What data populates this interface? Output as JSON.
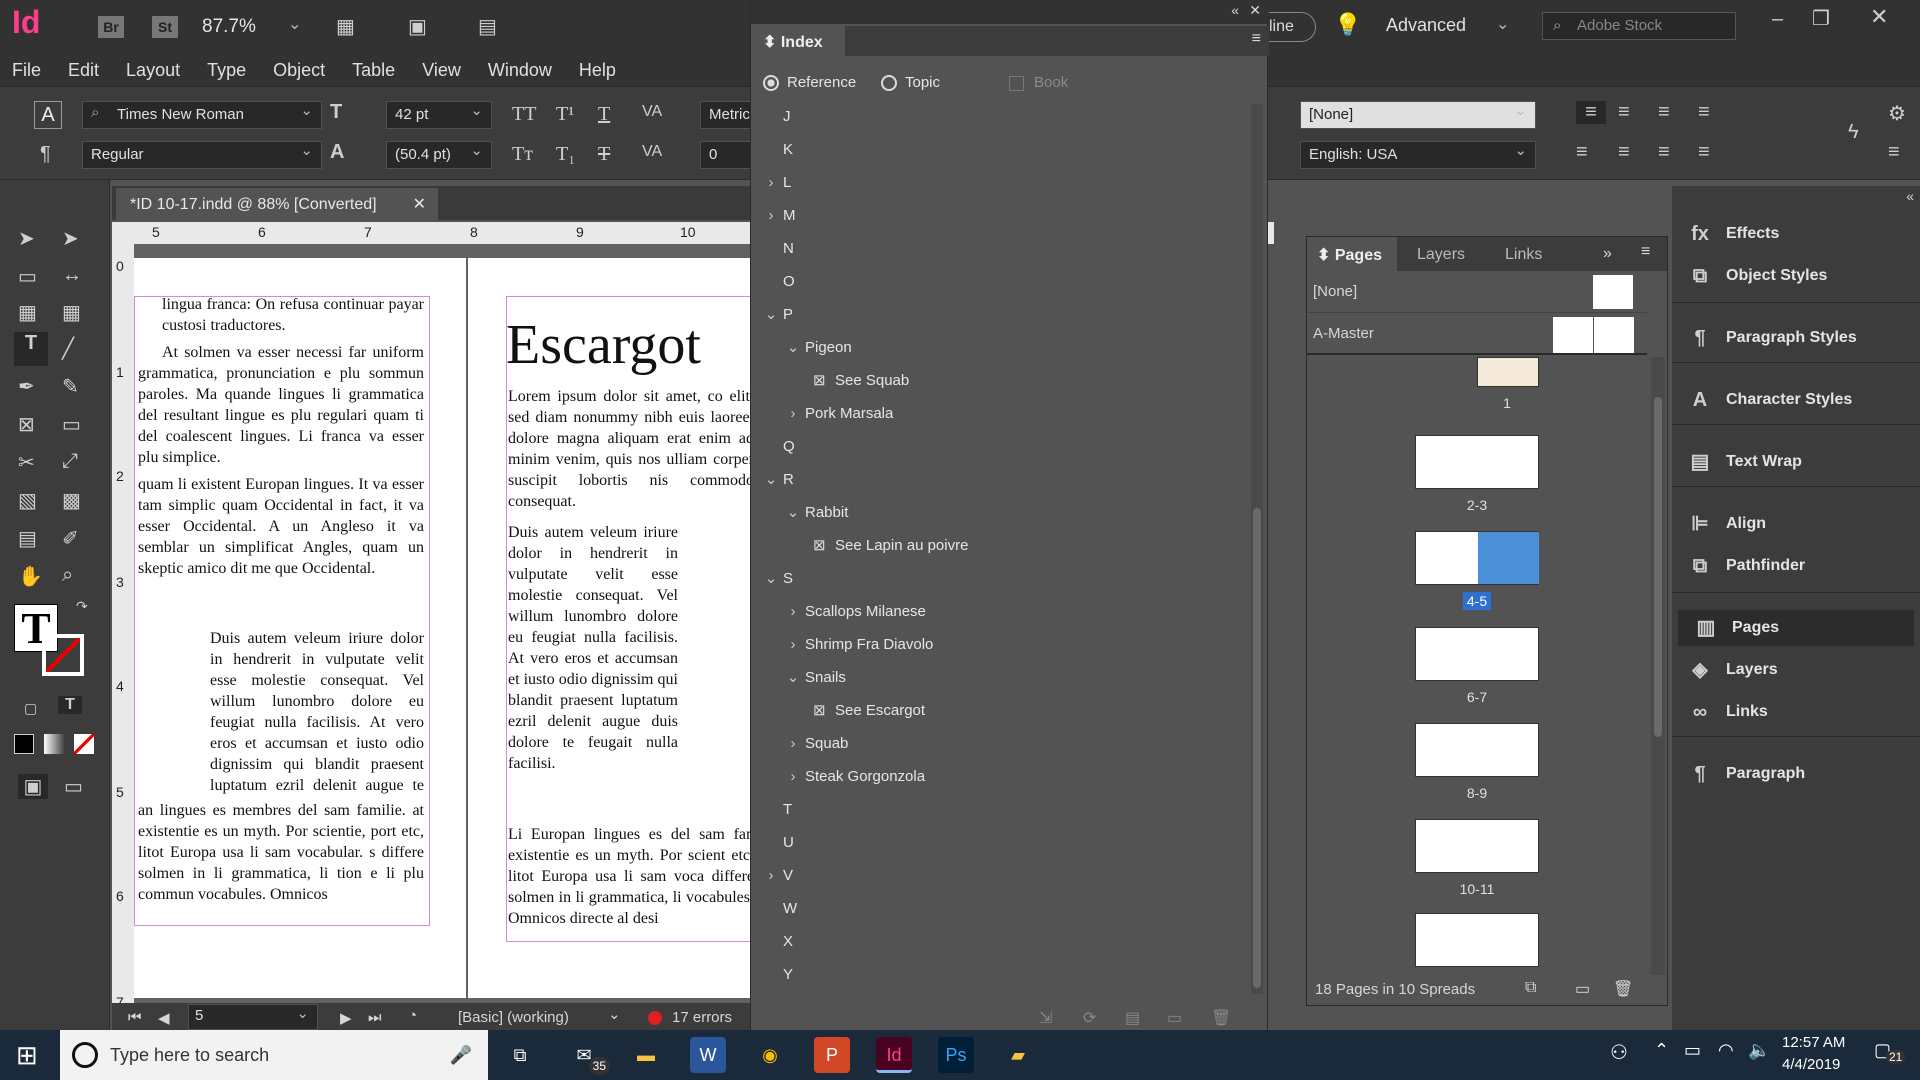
{
  "app": {
    "logo": "Id",
    "bridge": "Br",
    "stock": "St",
    "zoom": "87.7%",
    "workspace": "Advanced",
    "search_placeholder": "Adobe Stock",
    "online": "line"
  },
  "menu": [
    "File",
    "Edit",
    "Layout",
    "Type",
    "Object",
    "Table",
    "View",
    "Window",
    "Help"
  ],
  "control": {
    "font_family": "Times New Roman",
    "font_style": "Regular",
    "font_size": "42 pt",
    "leading": "(50.4 pt)",
    "kerning": "Metrics",
    "tracking": "0",
    "para_style": "[None]",
    "language": "English: USA"
  },
  "document": {
    "tab_title": "*ID 10-17.indd @ 88% [Converted]",
    "ruler_h": [
      "5",
      "6",
      "7",
      "8",
      "9",
      "10"
    ],
    "ruler_v": [
      "0",
      "1",
      "2",
      "3",
      "4",
      "5",
      "6",
      "7"
    ],
    "heading": "Escargot",
    "left_col": [
      "lingua franca: On refusa continuar payar custosi traductores.",
      "At solmen va esser necessi far uniform grammatica, pronunciation e plu sommun paroles. Ma quande lingues li grammatica del resultant lingue es plu regulari quam ti del coalescent lingues. Li franca va esser plu simplice.",
      "quam li existent Europan lingues. It va esser tam simplic quam Occidental in fact, it va esser Occidental. A un Angleso it va semblar un simplificat Angles, quam un skeptic amico dit me que Occidental.",
      "Duis autem veleum iriure dolor in hendrerit in vulputate velit esse molestie consequat. Vel willum lunombro dolore eu feugiat nulla facilisis. At vero eros et accumsan et iusto odio dignissim qui blandit praesent luptatum ezril delenit augue te feugait nulla facilisi.",
      "an lingues es membres del sam familie. at existentie es un myth. Por scientie, port etc, litot Europa usa li sam vocabular. s differe solmen in li grammatica, li tion e li plu commun vocabules. Omnicos"
    ],
    "right_col": [
      "Lorem ipsum dolor sit amet, co elit, sed diam nonummy nibh euis laoreet dolore magna aliquam erat enim ad minim venim, quis nos ulliam corper suscipit lobortis nis commodo consequat.",
      "Duis autem veleum iriure dolor in hendrerit in vulputate velit esse molestie consequat. Vel willum lunombro dolore eu feugiat nulla facilisis. At vero eros et accumsan et iusto odio dignissim qui blandit praesent luptatum ezril delenit augue duis dolore te feugait nulla facilisi.",
      "Li Europan lingues es del sam fan existentie es un myth. Por scient etc, litot Europa usa li sam voca differe solmen in li grammatica, li vocabules. Omnicos directe al desi"
    ]
  },
  "status": {
    "page": "5",
    "style": "[Basic] (working)",
    "errors": "17 errors"
  },
  "index": {
    "title": "Index",
    "opt_reference": "Reference",
    "opt_topic": "Topic",
    "opt_book": "Book",
    "rows": [
      {
        "text": "J",
        "level": 0,
        "arrow": ""
      },
      {
        "text": "K",
        "level": 0,
        "arrow": ""
      },
      {
        "text": "L",
        "level": 0,
        "arrow": "›"
      },
      {
        "text": "M",
        "level": 0,
        "arrow": "›"
      },
      {
        "text": "N",
        "level": 0,
        "arrow": ""
      },
      {
        "text": "O",
        "level": 0,
        "arrow": ""
      },
      {
        "text": "P",
        "level": 0,
        "arrow": "⌄"
      },
      {
        "text": "Pigeon",
        "level": 1,
        "arrow": "⌄"
      },
      {
        "text": "See Squab",
        "level": 2,
        "arrow": ""
      },
      {
        "text": "Pork Marsala",
        "level": 1,
        "arrow": "›"
      },
      {
        "text": "Q",
        "level": 0,
        "arrow": ""
      },
      {
        "text": "R",
        "level": 0,
        "arrow": "⌄"
      },
      {
        "text": "Rabbit",
        "level": 1,
        "arrow": "⌄"
      },
      {
        "text": "See Lapin au poivre",
        "level": 2,
        "arrow": ""
      },
      {
        "text": "S",
        "level": 0,
        "arrow": "⌄"
      },
      {
        "text": "Scallops Milanese",
        "level": 1,
        "arrow": "›"
      },
      {
        "text": "Shrimp Fra Diavolo",
        "level": 1,
        "arrow": "›"
      },
      {
        "text": "Snails",
        "level": 1,
        "arrow": "⌄"
      },
      {
        "text": "See Escargot",
        "level": 2,
        "arrow": ""
      },
      {
        "text": "Squab",
        "level": 1,
        "arrow": "›"
      },
      {
        "text": "Steak Gorgonzola",
        "level": 1,
        "arrow": "›"
      },
      {
        "text": "T",
        "level": 0,
        "arrow": ""
      },
      {
        "text": "U",
        "level": 0,
        "arrow": ""
      },
      {
        "text": "V",
        "level": 0,
        "arrow": "›"
      },
      {
        "text": "W",
        "level": 0,
        "arrow": ""
      },
      {
        "text": "X",
        "level": 0,
        "arrow": ""
      },
      {
        "text": "Y",
        "level": 0,
        "arrow": ""
      }
    ]
  },
  "pages": {
    "tabs": [
      "Pages",
      "Layers",
      "Links"
    ],
    "none": "[None]",
    "master": "A-Master",
    "thumbs": [
      "1",
      "2-3",
      "4-5",
      "6-7",
      "8-9",
      "10-11"
    ],
    "selected": "4-5",
    "footer": "18 Pages in 10 Spreads"
  },
  "right_panels": [
    "Effects",
    "Object Styles",
    "Paragraph Styles",
    "Character Styles",
    "Text Wrap",
    "Align",
    "Pathfinder",
    "Pages",
    "Layers",
    "Links",
    "Paragraph"
  ],
  "taskbar": {
    "search": "Type here to search",
    "mail_badge": "35",
    "time": "12:57 AM",
    "date": "4/4/2019",
    "notif": "21"
  }
}
